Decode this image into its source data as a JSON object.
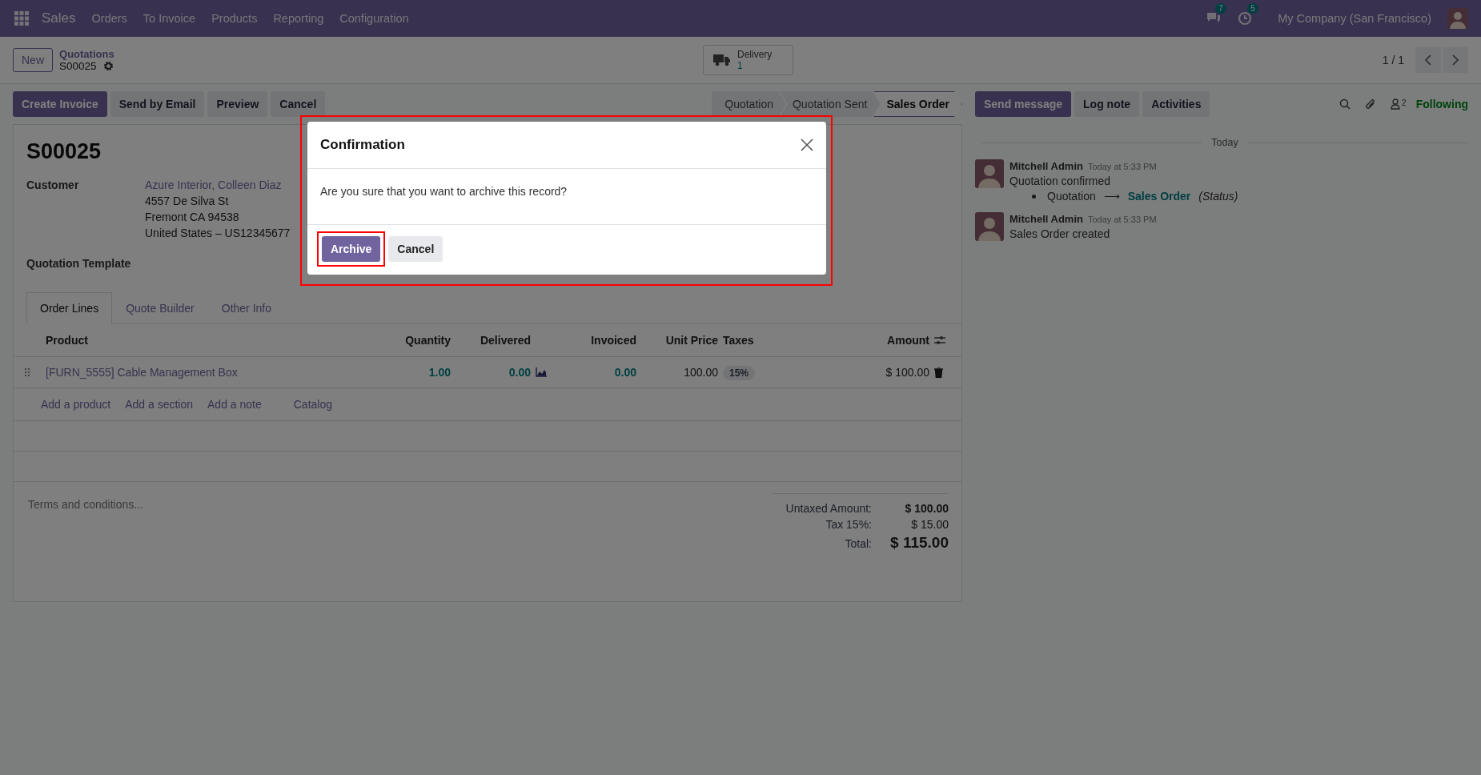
{
  "navbar": {
    "app_name": "Sales",
    "menu": [
      "Orders",
      "To Invoice",
      "Products",
      "Reporting",
      "Configuration"
    ],
    "messages_count": "7",
    "activities_count": "5",
    "company": "My Company (San Francisco)"
  },
  "control_panel": {
    "new_button": "New",
    "breadcrumb": "Quotations",
    "record_name": "S00025",
    "delivery": {
      "label": "Delivery",
      "count": "1"
    },
    "pager": "1 / 1"
  },
  "action_buttons": [
    {
      "label": "Create Invoice",
      "primary": true
    },
    {
      "label": "Send by Email",
      "primary": false
    },
    {
      "label": "Preview",
      "primary": false
    },
    {
      "label": "Cancel",
      "primary": false
    }
  ],
  "statusbar": [
    {
      "label": "Quotation",
      "selected": false
    },
    {
      "label": "Quotation Sent",
      "selected": false
    },
    {
      "label": "Sales Order",
      "selected": true
    }
  ],
  "form": {
    "title": "S00025",
    "customer_label": "Customer",
    "customer_name": "Azure Interior, Colleen Diaz",
    "address": [
      "4557 De Silva St",
      "Fremont CA 94538",
      "United States – US12345677"
    ],
    "template_label": "Quotation Template",
    "tabs": [
      {
        "label": "Order Lines",
        "selected": true
      },
      {
        "label": "Quote Builder",
        "selected": false
      },
      {
        "label": "Other Info",
        "selected": false
      }
    ],
    "columns": [
      "Product",
      "Quantity",
      "Delivered",
      "Invoiced",
      "Unit Price",
      "Taxes",
      "Amount"
    ],
    "rows": [
      {
        "product": "[FURN_5555] Cable Management Box",
        "quantity": "1.00",
        "delivered": "0.00",
        "invoiced": "0.00",
        "unit_price": "100.00",
        "taxes": "15%",
        "amount": "$ 100.00"
      }
    ],
    "add_links": [
      "Add a product",
      "Add a section",
      "Add a note",
      "Catalog"
    ],
    "terms_placeholder": "Terms and conditions...",
    "totals": [
      {
        "label": "Untaxed Amount:",
        "value": "$ 100.00",
        "kind": "subtotal"
      },
      {
        "label": "Tax 15%:",
        "value": "$ 15.00",
        "kind": "tax"
      },
      {
        "label": "Total:",
        "value": "$ 115.00",
        "kind": "total"
      }
    ]
  },
  "chatter": {
    "buttons": [
      {
        "label": "Send message",
        "primary": true
      },
      {
        "label": "Log note",
        "primary": false
      },
      {
        "label": "Activities",
        "primary": false
      }
    ],
    "followers_count": "2",
    "following": "Following",
    "date": "Today",
    "messages": [
      {
        "author": "Mitchell Admin",
        "time": "Today at 5:33 PM",
        "body": "Quotation confirmed",
        "tracking": {
          "old": "Quotation",
          "arrow": "⟶",
          "new": "Sales Order",
          "field": "(Status)"
        }
      },
      {
        "author": "Mitchell Admin",
        "time": "Today at 5:33 PM",
        "body": "Sales Order created"
      }
    ]
  },
  "dialog": {
    "title": "Confirmation",
    "message": "Are you sure that you want to archive this record?",
    "buttons": [
      {
        "label": "Archive",
        "primary": true,
        "highlighted": true
      },
      {
        "label": "Cancel",
        "primary": false,
        "highlighted": false
      }
    ]
  }
}
